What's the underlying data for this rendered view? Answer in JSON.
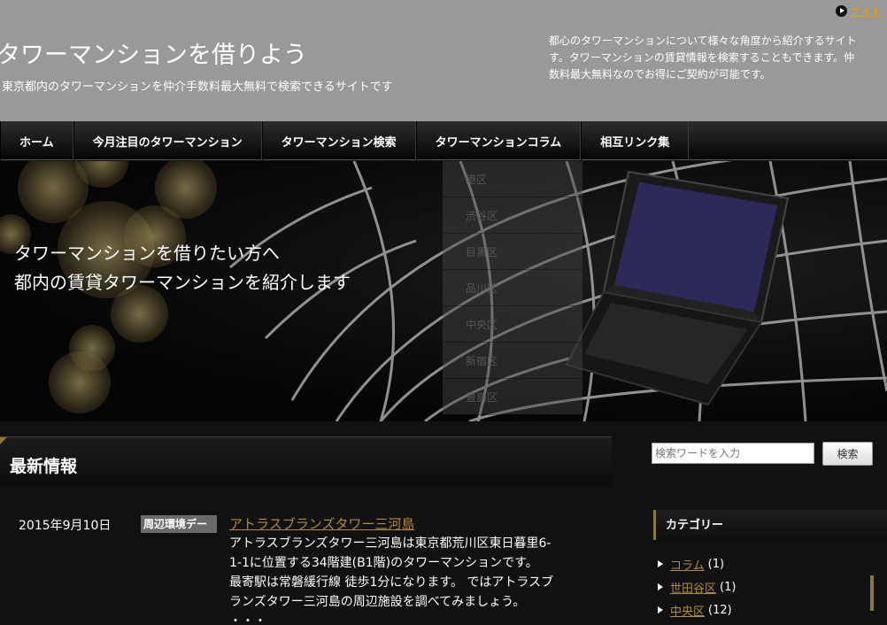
{
  "header": {
    "title": "タワーマンションを借りよう",
    "tagline": "東京都内のタワーマンションを仲介手数料最大無料で検索できるサイトです",
    "description_lines": [
      "都心のタワーマンションについて様々な角度から紹介するサイト",
      "す。タワーマンションの賃貸情報を検索することもできます。仲",
      "数料最大無料なのでお得にご契約が可能です。"
    ],
    "sitemap_label": "サイト"
  },
  "nav": {
    "items": [
      "ホーム",
      "今月注目のタワーマンション",
      "タワーマンション検索",
      "タワーマンションコラム",
      "相互リンク集"
    ]
  },
  "hero": {
    "catch_lines": [
      "タワーマンションを借りたい方へ",
      "都内の賃貸タワーマンションを紹介します"
    ],
    "ward_menu": [
      "港区",
      "渋谷区",
      "目黒区",
      "品川区",
      "中央区",
      "新宿区",
      "豊島区"
    ]
  },
  "main": {
    "section_title": "最新情報",
    "post": {
      "date": "2015年9月10日",
      "category": "周辺環境デー",
      "title": "アトラスブランズタワー三河島",
      "excerpt_lines": [
        "アトラスブランズタワー三河島は東京都荒川区東日暮里6-",
        "1-1に位置する34階建(B1階)のタワーマンションです。",
        "最寄駅は常磐緩行線 徒歩1分になります。 ではアトラスブ",
        "ランズタワー三河島の周辺施設を調べてみましょう。",
        "・・・"
      ]
    }
  },
  "sidebar": {
    "search_placeholder": "検索ワードを入力",
    "search_button": "検索",
    "category_title": "カテゴリー",
    "categories": [
      {
        "name": "コラム",
        "count": "(1)"
      },
      {
        "name": "世田谷区",
        "count": "(1)"
      },
      {
        "name": "中央区",
        "count": "(12)"
      }
    ]
  },
  "colors": {
    "header_bg": "#999999",
    "accent_gold": "#b08a40",
    "body_bg": "#111111"
  }
}
